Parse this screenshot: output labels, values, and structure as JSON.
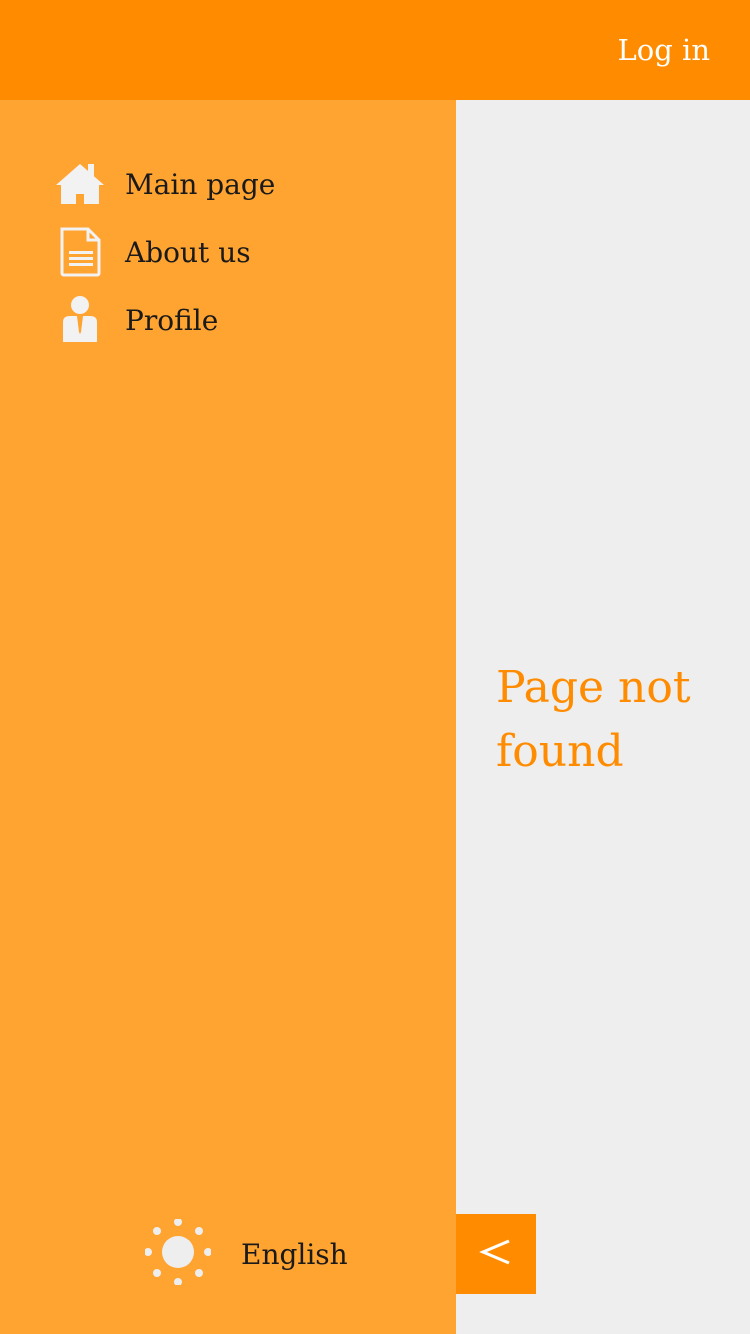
{
  "header": {
    "login_label": "Log in"
  },
  "sidebar": {
    "items": [
      {
        "label": "Main page",
        "icon": "home-icon"
      },
      {
        "label": "About us",
        "icon": "document-icon"
      },
      {
        "label": "Profile",
        "icon": "person-icon"
      }
    ],
    "language": {
      "label": "English",
      "icon": "sun-icon"
    }
  },
  "main": {
    "message": "Page not found"
  },
  "controls": {
    "collapse_icon": "chevron-left-icon"
  },
  "colors": {
    "header_bg": "#ff8c00",
    "sidebar_bg": "#ffa331",
    "content_bg": "#eeeeee",
    "accent": "#ff8c00",
    "icon": "#f2f2f2",
    "text_dark": "#1a1a1a"
  }
}
